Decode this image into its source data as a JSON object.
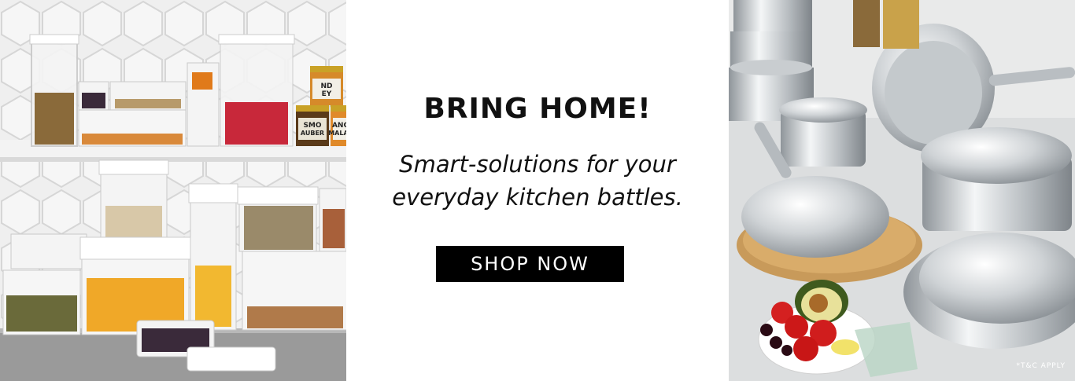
{
  "banner": {
    "headline": "BRING HOME!",
    "tagline_line1": "Smart-solutions for your",
    "tagline_line2": "everyday kitchen battles.",
    "cta_label": "SHOP NOW",
    "disclaimer": "*T&C APPLY",
    "colors": {
      "cta_background": "#000000",
      "cta_text": "#ffffff",
      "text": "#111111",
      "background": "#ffffff"
    }
  },
  "left_image": {
    "subject": "storage-containers-photo",
    "jar_labels": [
      "ND",
      "EY",
      "SMO",
      "AUBER",
      "ANGE",
      "MALADE"
    ]
  },
  "right_image": {
    "subject": "cookware-set-photo"
  }
}
